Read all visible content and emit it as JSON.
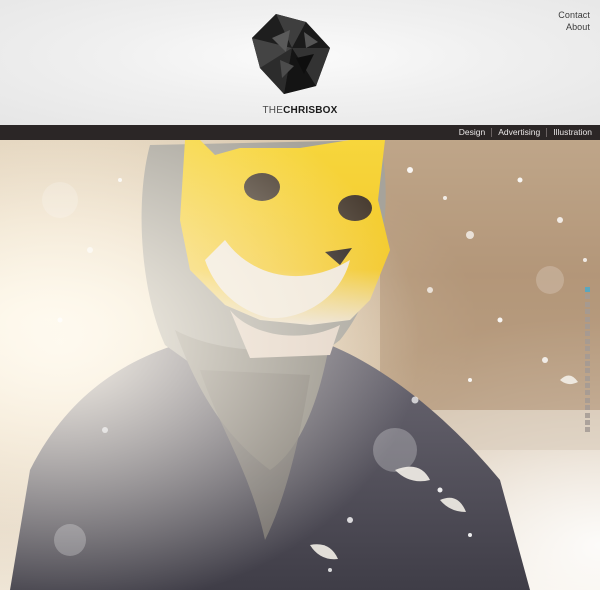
{
  "header": {
    "brand_prefix": "THE",
    "brand_name": "CHRISBOX",
    "links": [
      {
        "label": "Contact"
      },
      {
        "label": "About"
      }
    ]
  },
  "nav": {
    "items": [
      {
        "label": "Design"
      },
      {
        "label": "Advertising"
      },
      {
        "label": "Illustration"
      }
    ]
  },
  "hero": {
    "slide_count": 20,
    "active_slide": 1
  },
  "colors": {
    "navbar": "#2b2626",
    "header_bg": "#efefef",
    "mask_yellow": "#f6d23a",
    "active_dot": "#5aa7bf",
    "inactive_dot": "#a39a94"
  }
}
